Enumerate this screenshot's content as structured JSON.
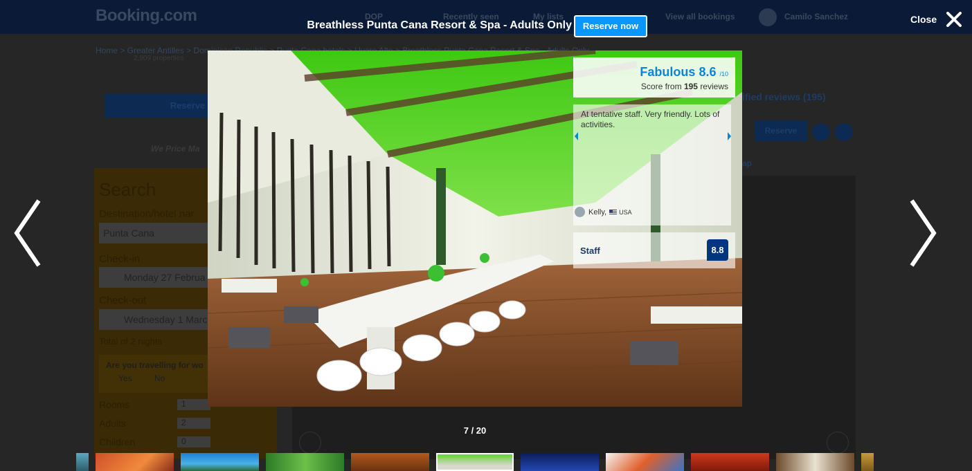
{
  "background_page": {
    "logo": "Booking.com",
    "nav": [
      "DOP",
      "Recently seen",
      "My lists",
      "View all bookings",
      "Camilo Sanchez"
    ],
    "breadcrumb": "Home  >  Greater Antilles  >  Dominican Republic  >  Punta Cana hotels  >  Uvero Alto  >  Breathless Punta Cana Resort & Spa - Adults Only",
    "breadcrumb_sub": "2,909 properties",
    "reserve_label": "Reserve",
    "price_match": "We Price Ma",
    "search": {
      "title": "Search",
      "destination_label": "Destination/hotel nar",
      "destination_value": "Punta Cana",
      "checkin_label": "Check-in",
      "checkin_value": "Monday 27 Februa",
      "checkout_label": "Check-out",
      "checkout_value": "Wednesday 1 Marc",
      "nights": "Total of 2 nights",
      "travel_question": "Are you travelling for wo",
      "yes": "Yes",
      "no": "No",
      "rooms_label": "Rooms",
      "rooms_value": "1",
      "adults_label": "Adults",
      "adults_value": "2",
      "children_label": "Children",
      "children_value": "0"
    },
    "reviews_link": "ified reviews (195)",
    "reserve_right": "Reserve",
    "map_link": "ap"
  },
  "lightbox": {
    "title": "Breathless Punta Cana Resort & Spa - Adults Only",
    "reserve_now": "Reserve now",
    "close_label": "Close",
    "counter": "7 / 20",
    "score": {
      "word": "Fabulous",
      "value": "8.6",
      "out_of": "/10",
      "sub_prefix": "Score from",
      "review_count": "195",
      "sub_suffix": "reviews"
    },
    "review": {
      "text": "At tentative staff. Very friendly. Lots of activities.",
      "author": "Kelly,",
      "country": "USA"
    },
    "category": {
      "label": "Staff",
      "score": "8.8"
    }
  },
  "colors": {
    "accent_blue": "#0896ff",
    "score_blue": "#0a85d9",
    "brand_navy": "#003580"
  },
  "icons": {
    "close": "close-x-icon",
    "prev": "chevron-left-icon",
    "next": "chevron-right-icon"
  }
}
